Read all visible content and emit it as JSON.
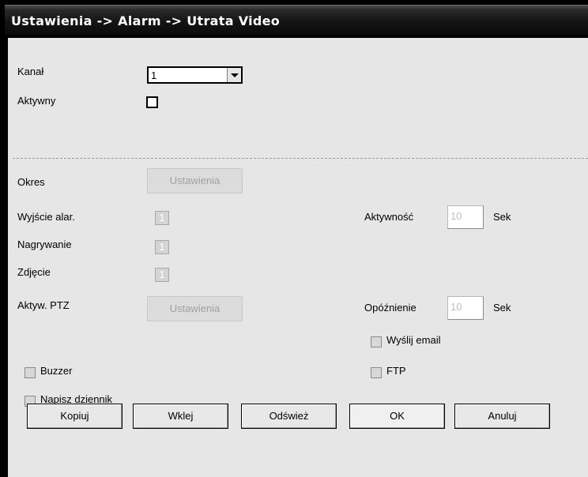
{
  "window": {
    "title": "Ustawienia -> Alarm -> Utrata Video"
  },
  "channel": {
    "label": "Kanał",
    "value": "1"
  },
  "active": {
    "label": "Aktywny",
    "checked": false
  },
  "period": {
    "label": "Okres",
    "button": "Ustawienia"
  },
  "alarm_output": {
    "label": "Wyjście alar.",
    "value": "1"
  },
  "recording": {
    "label": "Nagrywanie",
    "value": "1"
  },
  "snapshot": {
    "label": "Zdjęcie",
    "value": "1"
  },
  "ptz": {
    "label": "Aktyw. PTZ",
    "button": "Ustawienia"
  },
  "activity": {
    "label": "Aktywność",
    "value": "10",
    "unit": "Sek"
  },
  "delay": {
    "label": "Opóźnienie",
    "value": "10",
    "unit": "Sek"
  },
  "send_email": {
    "label": "Wyślij email",
    "checked": false
  },
  "ftp": {
    "label": "FTP",
    "checked": false
  },
  "buzzer": {
    "label": "Buzzer",
    "checked": false
  },
  "write_log": {
    "label": "Napisz dziennik",
    "checked": false
  },
  "buttons": {
    "copy": "Kopiuj",
    "paste": "Wklej",
    "refresh": "Odśwież",
    "ok": "OK",
    "cancel": "Anuluj"
  }
}
